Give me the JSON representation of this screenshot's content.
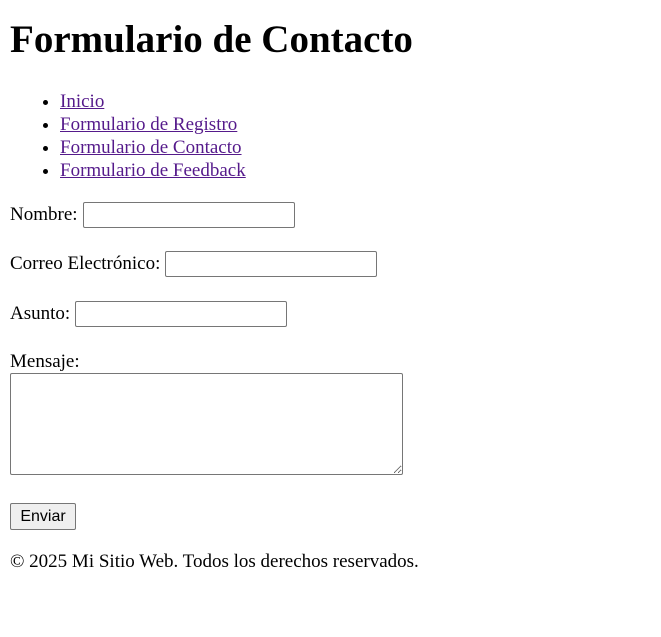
{
  "header": {
    "title": "Formulario de Contacto"
  },
  "nav": {
    "items": [
      {
        "label": "Inicio"
      },
      {
        "label": "Formulario de Registro"
      },
      {
        "label": "Formulario de Contacto"
      },
      {
        "label": "Formulario de Feedback"
      }
    ]
  },
  "form": {
    "nombre_label": "Nombre:",
    "nombre_value": "",
    "correo_label": "Correo Electrónico:",
    "correo_value": "",
    "asunto_label": "Asunto:",
    "asunto_value": "",
    "mensaje_label": "Mensaje:",
    "mensaje_value": "",
    "submit_label": "Enviar"
  },
  "footer": {
    "text": "© 2025 Mi Sitio Web. Todos los derechos reservados."
  },
  "colors": {
    "link_visited": "#551a8b",
    "text": "#000000",
    "background": "#ffffff"
  }
}
